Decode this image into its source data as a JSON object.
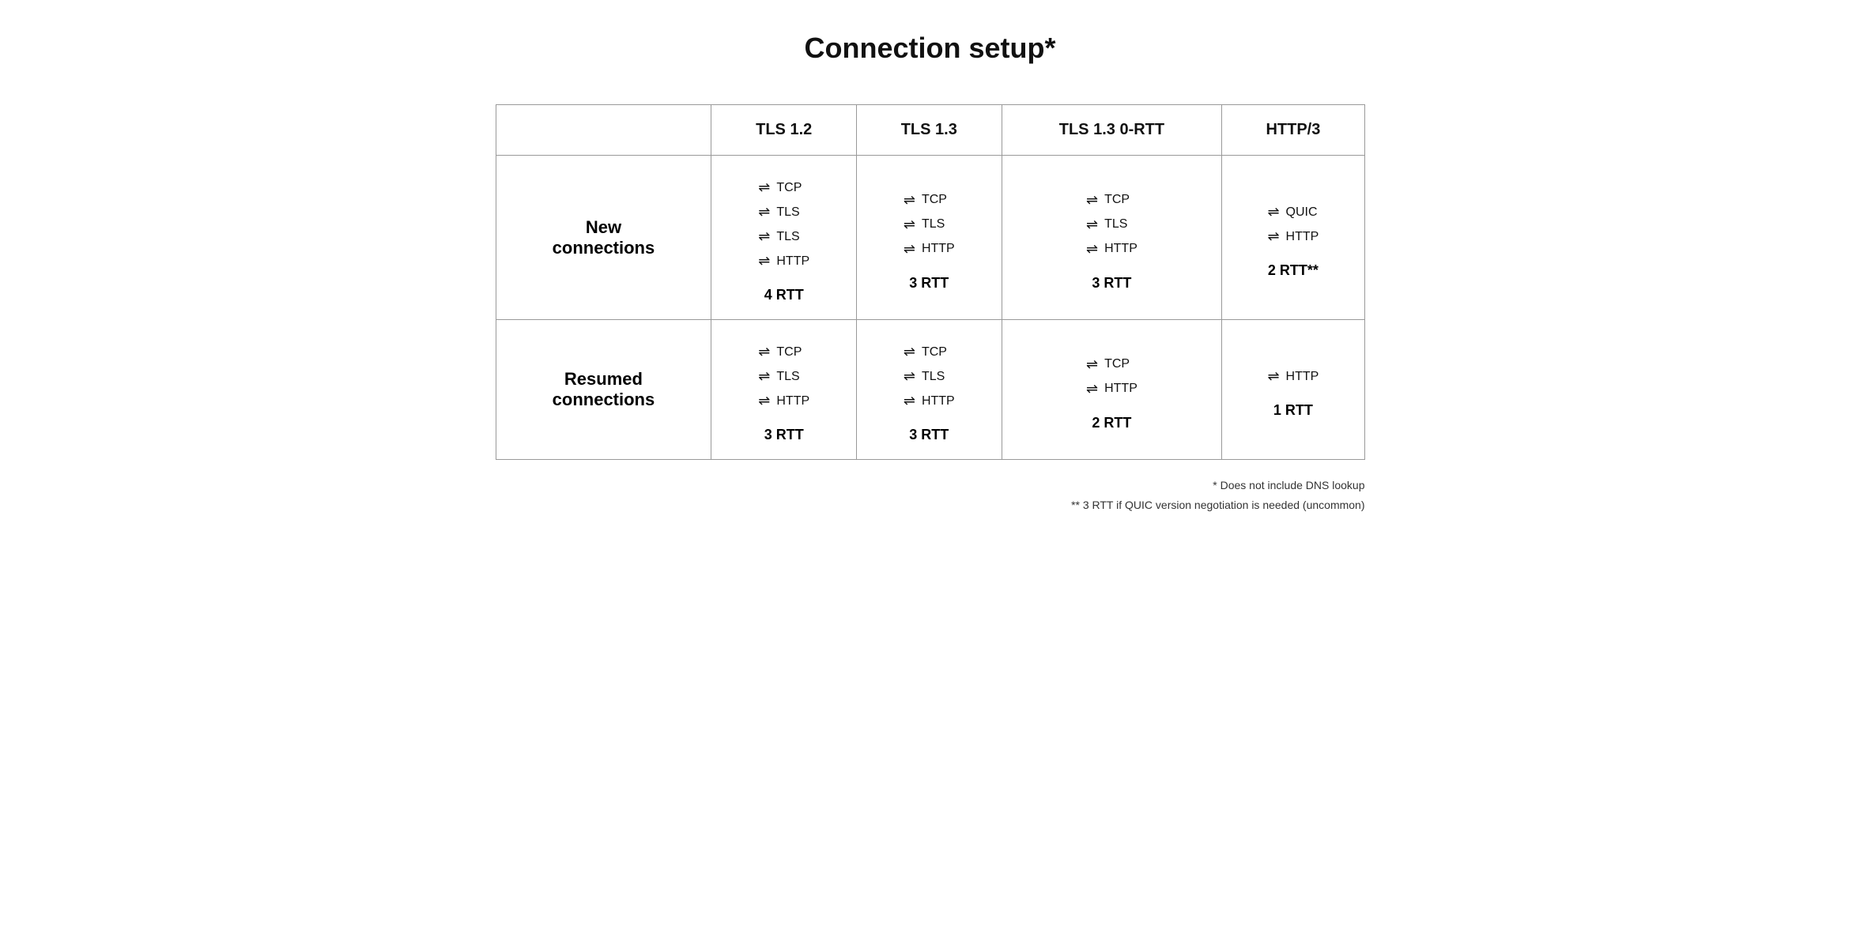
{
  "title": "Connection setup*",
  "table": {
    "headers": [
      "",
      "TLS 1.2",
      "TLS 1.3",
      "TLS 1.3 0-RTT",
      "HTTP/3"
    ],
    "rows": [
      {
        "label": "New\nconnections",
        "cells": [
          {
            "steps": [
              "TCP",
              "TLS",
              "TLS",
              "HTTP"
            ],
            "rtt": "4 RTT"
          },
          {
            "steps": [
              "TCP",
              "TLS",
              "HTTP"
            ],
            "rtt": "3 RTT"
          },
          {
            "steps": [
              "TCP",
              "TLS",
              "HTTP"
            ],
            "rtt": "3 RTT"
          },
          {
            "steps": [
              "QUIC",
              "HTTP"
            ],
            "rtt": "2 RTT**"
          }
        ]
      },
      {
        "label": "Resumed\nconnections",
        "cells": [
          {
            "steps": [
              "TCP",
              "TLS",
              "HTTP"
            ],
            "rtt": "3 RTT"
          },
          {
            "steps": [
              "TCP",
              "TLS",
              "HTTP"
            ],
            "rtt": "3 RTT"
          },
          {
            "steps": [
              "TCP",
              "HTTP"
            ],
            "rtt": "2 RTT"
          },
          {
            "steps": [
              "HTTP"
            ],
            "rtt": "1 RTT"
          }
        ]
      }
    ]
  },
  "footnotes": [
    "* Does not include DNS lookup",
    "** 3 RTT if QUIC version negotiation is needed (uncommon)"
  ]
}
